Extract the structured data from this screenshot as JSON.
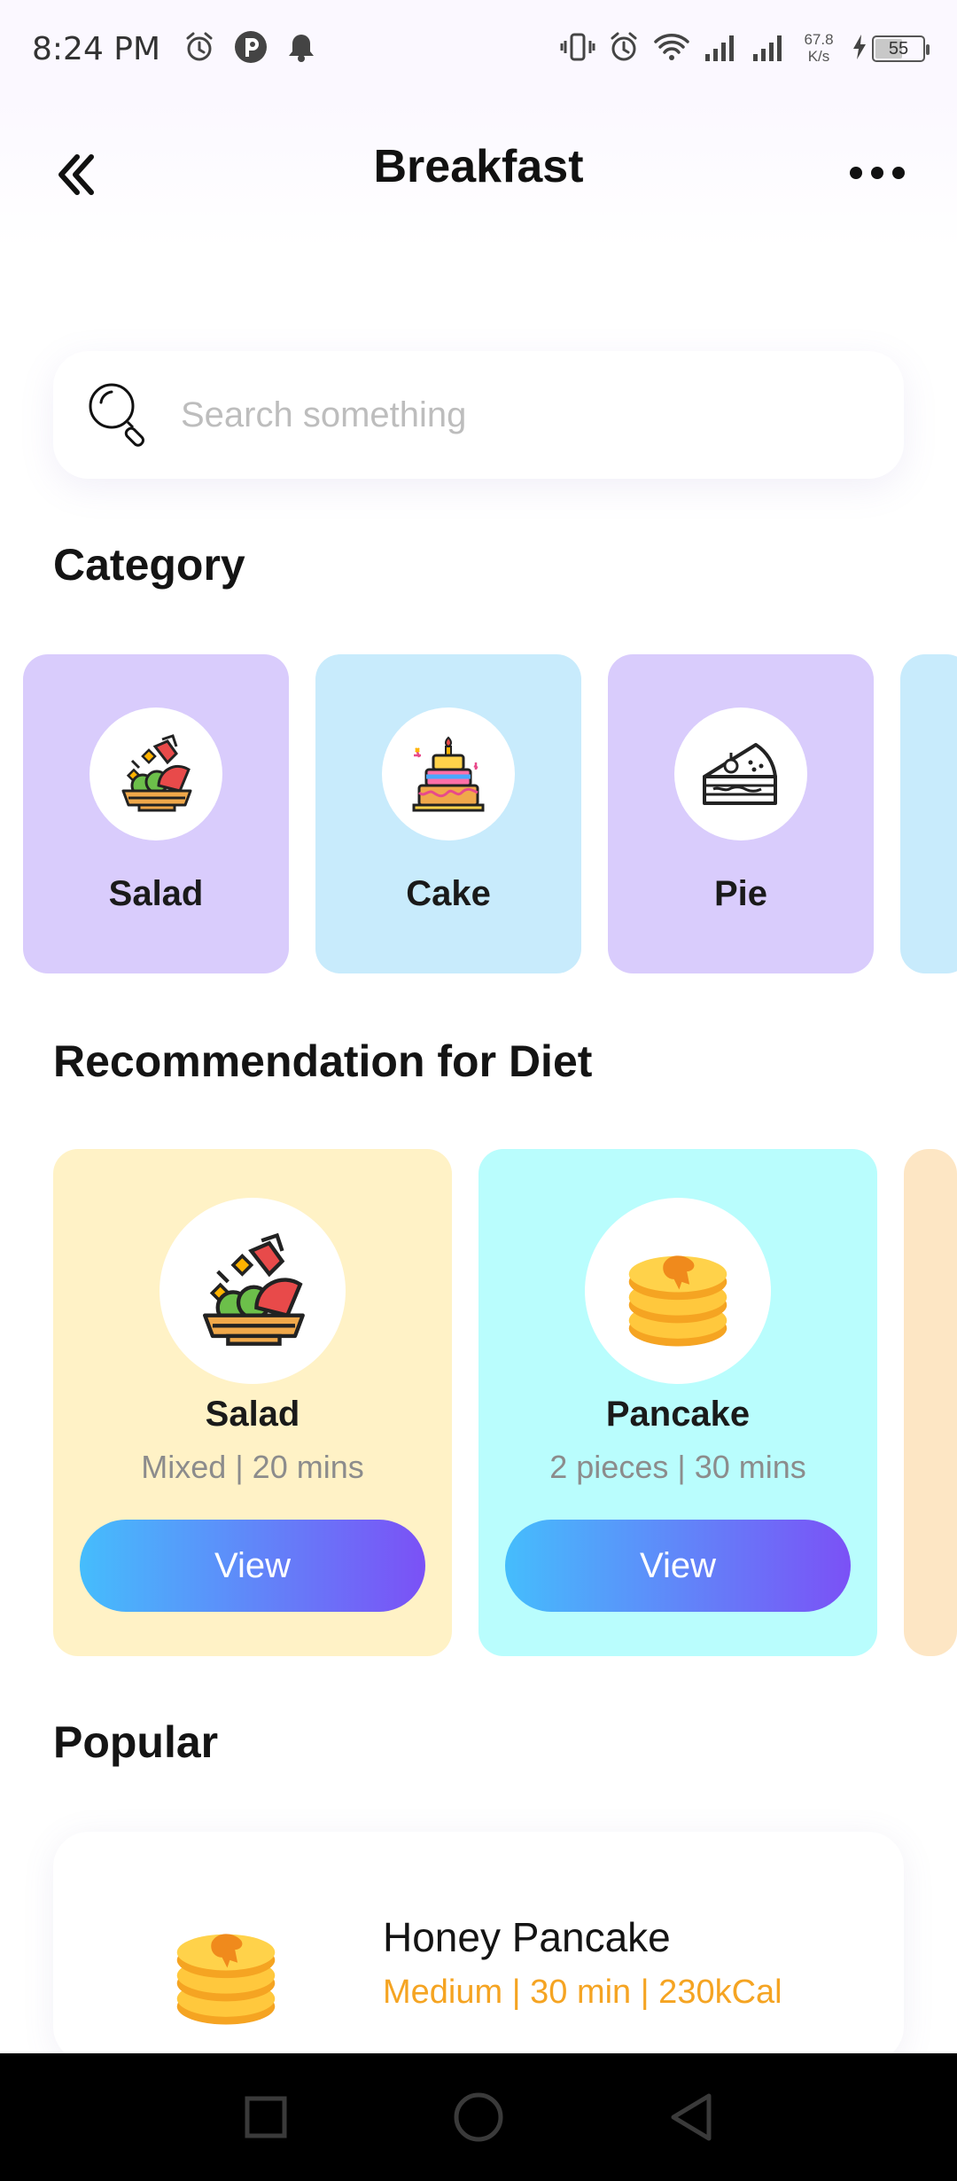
{
  "status_bar": {
    "time": "8:24 PM",
    "net_speed_value": "67.8",
    "net_speed_unit": "K/s",
    "battery_level": "55",
    "icons": [
      "alarm-icon",
      "app-icon",
      "notification-bell-icon",
      "vibrate-icon",
      "alarm-icon",
      "wifi-icon",
      "signal-icon",
      "signal-icon",
      "charging-icon",
      "battery-icon"
    ]
  },
  "header": {
    "title": "Breakfast",
    "back_icon": "double-chevron-left-icon",
    "more_icon": "more-horizontal-icon"
  },
  "search": {
    "placeholder": "Search something",
    "value": "",
    "icon": "search-icon"
  },
  "category": {
    "title": "Category",
    "items": [
      {
        "label": "Salad",
        "icon": "salad-icon",
        "color": "#d9ccfc"
      },
      {
        "label": "Cake",
        "icon": "cake-icon",
        "color": "#c8ebfc"
      },
      {
        "label": "Pie",
        "icon": "pie-icon",
        "color": "#d9ccfc"
      }
    ]
  },
  "recommendation": {
    "title": "Recommendation for Diet",
    "items": [
      {
        "name": "Salad",
        "meta": "Mixed | 20 mins",
        "button": "View",
        "icon": "salad-icon",
        "color": "#fff2c6"
      },
      {
        "name": "Pancake",
        "meta": "2 pieces | 30 mins",
        "button": "View",
        "icon": "pancake-icon",
        "color": "#b9fdfd"
      }
    ]
  },
  "popular": {
    "title": "Popular",
    "items": [
      {
        "name": "Honey Pancake",
        "meta": "Medium | 30 min | 230kCal",
        "icon": "pancake-icon"
      }
    ]
  },
  "colors": {
    "button_gradient_start": "#45bdfc",
    "button_gradient_end": "#7b51f6",
    "popular_meta": "#f5a422"
  },
  "nav_bar": {
    "icons": [
      "recent-apps-icon",
      "home-icon",
      "back-icon"
    ]
  }
}
